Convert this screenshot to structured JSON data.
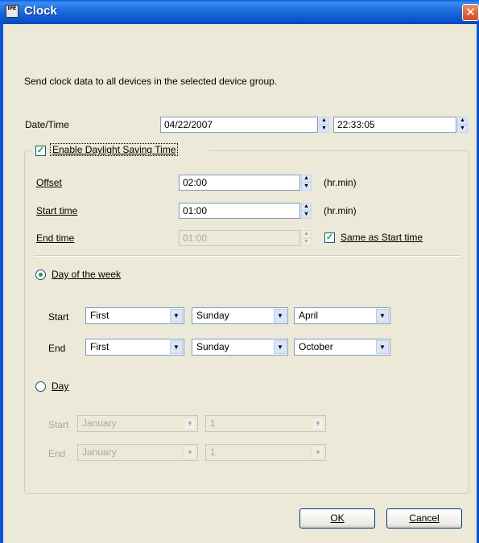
{
  "window": {
    "title": "Clock",
    "icon_label": "DME",
    "close_glyph": "✕"
  },
  "description": "Send clock data to all devices in the selected device group.",
  "datetime": {
    "label": "Date/Time",
    "date": "04/22/2007",
    "time": "22:33:05"
  },
  "dst": {
    "enable_label": "Enable Daylight Saving Time",
    "enabled": true,
    "offset": {
      "label": "Offset",
      "value": "02:00",
      "unit": "(hr.min)"
    },
    "start_time": {
      "label": "Start time",
      "value": "01:00",
      "unit": "(hr.min)"
    },
    "end_time": {
      "label": "End time",
      "value": "01:00"
    },
    "same_as_start": {
      "label": "Same as Start time",
      "checked": true
    }
  },
  "day_of_week": {
    "label": "Day of the week",
    "selected": true,
    "start": {
      "label": "Start",
      "ordinal": "First",
      "weekday": "Sunday",
      "month": "April"
    },
    "end": {
      "label": "End",
      "ordinal": "First",
      "weekday": "Sunday",
      "month": "October"
    }
  },
  "day": {
    "label": "Day",
    "selected": false,
    "start": {
      "label": "Start",
      "month": "January",
      "day": "1"
    },
    "end": {
      "label": "End",
      "month": "January",
      "day": "1"
    }
  },
  "buttons": {
    "ok": "OK",
    "cancel": "Cancel"
  },
  "glyphs": {
    "up": "▲",
    "down": "▼",
    "check": "✓"
  },
  "colors": {
    "titlebar": "#0b55d0",
    "dialog_bg": "#ece9d8",
    "check_green": "#21a121",
    "close_red": "#d54a20"
  }
}
